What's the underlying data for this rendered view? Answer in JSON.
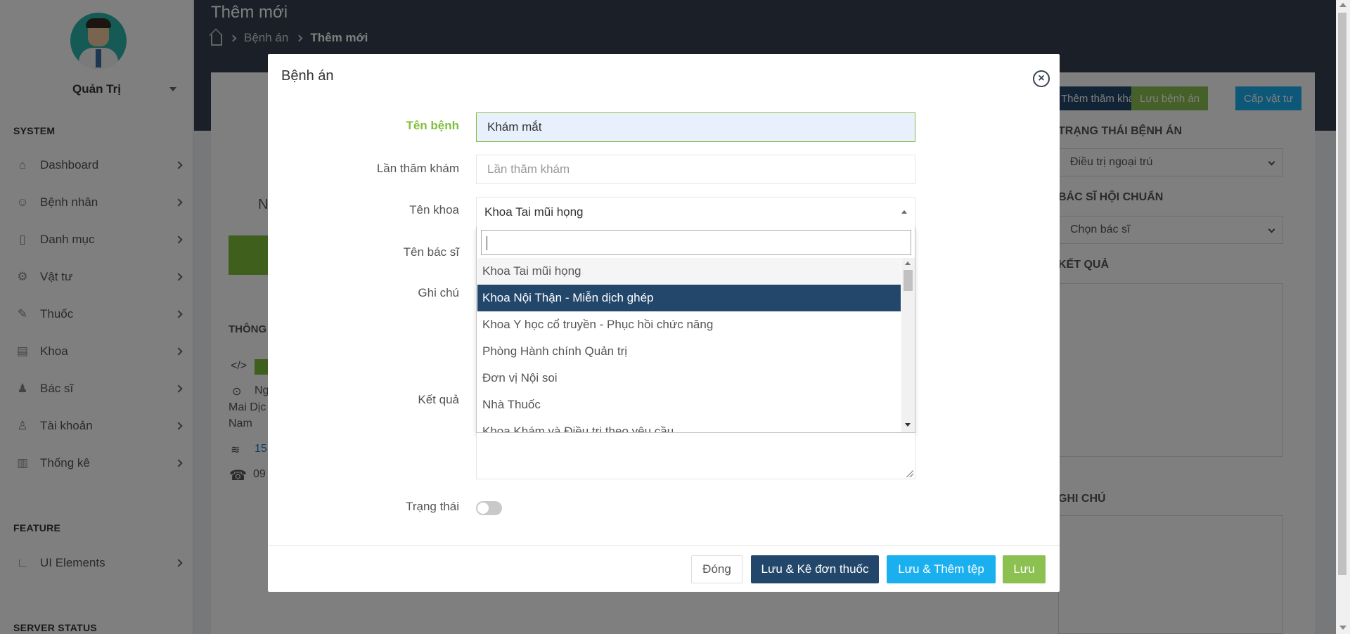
{
  "sidebar": {
    "user_name": "Quản Trị",
    "sections": {
      "system": "SYSTEM",
      "feature": "FEATURE",
      "server_status": "SERVER STATUS"
    },
    "items": [
      {
        "label": "Dashboard",
        "icon": "home-icon"
      },
      {
        "label": "Bệnh nhân",
        "icon": "user-icon"
      },
      {
        "label": "Danh mục",
        "icon": "document-icon"
      },
      {
        "label": "Vật tư",
        "icon": "gear-icon"
      },
      {
        "label": "Thuốc",
        "icon": "pen-icon"
      },
      {
        "label": "Khoa",
        "icon": "card-icon"
      },
      {
        "label": "Bác sĩ",
        "icon": "doctor-icon"
      },
      {
        "label": "Tài khoản",
        "icon": "account-icon"
      },
      {
        "label": "Thống kê",
        "icon": "chart-icon"
      }
    ],
    "feature_items": [
      {
        "label": "UI Elements",
        "icon": "element-icon"
      }
    ]
  },
  "header": {
    "title": "Thêm mới",
    "breadcrumb": [
      "Bệnh án",
      "Thêm mới"
    ]
  },
  "background": {
    "buttons": [
      "Thêm thăm khám",
      "Lưu bệnh án",
      "Cấp vật tư"
    ],
    "labels": {
      "status": "TRẠNG THÁI BỆNH ÁN",
      "consult_doctor": "BÁC SĨ HỘI CHUẨN",
      "result": "KẾT QUẢ",
      "note": "GHI CHÚ"
    },
    "status_value": "Điều trị ngoại trú",
    "doctor_placeholder": "Chọn bác sĩ",
    "left_fragments": {
      "n": "N",
      "info": "THÔNG",
      "address_1": "Ng",
      "address_2": "Mai Dịc",
      "address_3": "Nam",
      "code": "15",
      "phone": "09"
    }
  },
  "modal": {
    "title": "Bệnh án",
    "fields": {
      "disease_name_label": "Tên bệnh",
      "disease_name_value": "Khám mắt",
      "visit_label": "Lần thăm khám",
      "visit_placeholder": "Lần thăm khám",
      "department_label": "Tên khoa",
      "department_value": "Khoa Tai mũi họng",
      "doctor_label": "Tên bác sĩ",
      "note_label": "Ghi chú",
      "result_label": "Kết quả",
      "status_label": "Trạng thái"
    },
    "dropdown_options": [
      "Khoa Tai mũi họng",
      "Khoa Nội Thận - Miễn dịch ghép",
      "Khoa Y học cổ truyền - Phục hồi chức năng",
      "Phòng Hành chính Quản trị",
      "Đơn vị Nội soi",
      "Nhà Thuốc",
      "Khoa Khám và Điều trị theo yêu cầu"
    ],
    "selected_option_index": 1,
    "buttons": {
      "close": "Đóng",
      "save_prescribe": "Lưu & Kê đơn thuốc",
      "save_add_file": "Lưu & Thêm tệp",
      "save": "Lưu"
    }
  }
}
